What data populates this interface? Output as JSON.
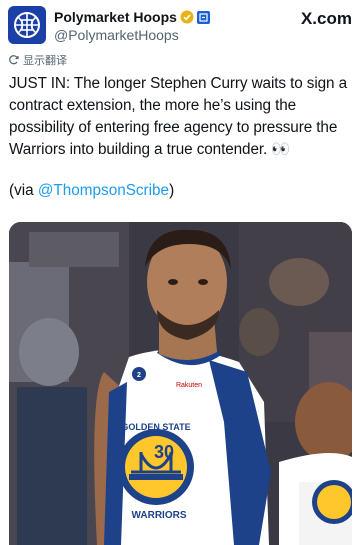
{
  "header": {
    "display_name": "Polymarket Hoops",
    "handle": "@PolymarketHoops",
    "logo_text": "X.com",
    "icons": {
      "avatar": "polymarket-logo",
      "verified": "gold-verified-badge",
      "affiliate": "org-affiliate-badge"
    }
  },
  "translate": {
    "label": "显示翻译",
    "icon": "translate-icon"
  },
  "tweet": {
    "text": "JUST IN: The longer Stephen Curry waits to sign a contract extension, the more he’s using the possibility of entering free agency to pressure the Warriors into building a true contender. 👀",
    "via_prefix": "(via ",
    "via_mention": "@ThompsonScribe",
    "via_suffix": ")"
  },
  "photo": {
    "jersey_team": "GOLDEN STATE",
    "jersey_team_bottom": "WARRIORS",
    "jersey_number": "30",
    "sponsor": "Rakuten",
    "patch_number": "2"
  },
  "colors": {
    "accent": "#1d9bf0",
    "warriors_blue": "#1d428a",
    "warriors_gold": "#ffc72c",
    "brand_blue": "#1a3fa6"
  }
}
